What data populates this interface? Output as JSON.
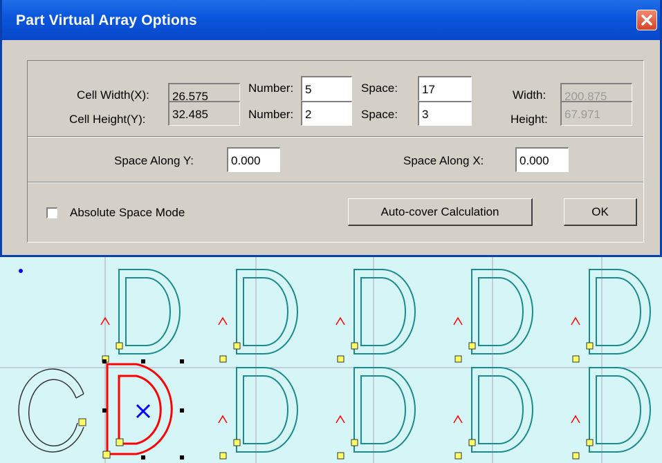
{
  "dialog": {
    "title": "Part Virtual Array Options",
    "close_icon": "close-icon",
    "cell_width": {
      "label": "Cell Width(X):",
      "value": "26.575"
    },
    "number_x": {
      "label": "Number:",
      "value": "5"
    },
    "space_x": {
      "label": "Space:",
      "value": "17"
    },
    "width": {
      "label": "Width:",
      "value": "200.875"
    },
    "cell_height": {
      "label": "Cell Height(Y):",
      "value": "32.485"
    },
    "number_y": {
      "label": "Number:",
      "value": "2"
    },
    "space_y": {
      "label": "Space:",
      "value": "3"
    },
    "height": {
      "label": "Height:",
      "value": "67.971"
    },
    "space_along_y": {
      "label": "Space Along Y:",
      "value": "0.000"
    },
    "space_along_x": {
      "label": "Space Along X:",
      "value": "0.000"
    },
    "absolute_space_mode": {
      "label": "Absolute Space Mode",
      "checked": false
    },
    "auto_cover_button": "Auto-cover Calculation",
    "ok_button": "OK"
  },
  "canvas": {
    "background": "#d6f5f7",
    "array_columns": 5,
    "array_rows": 2,
    "part_color": "#1a8a8a",
    "selected_color": "#ff0000",
    "center_marker_color": "#0000ff"
  }
}
